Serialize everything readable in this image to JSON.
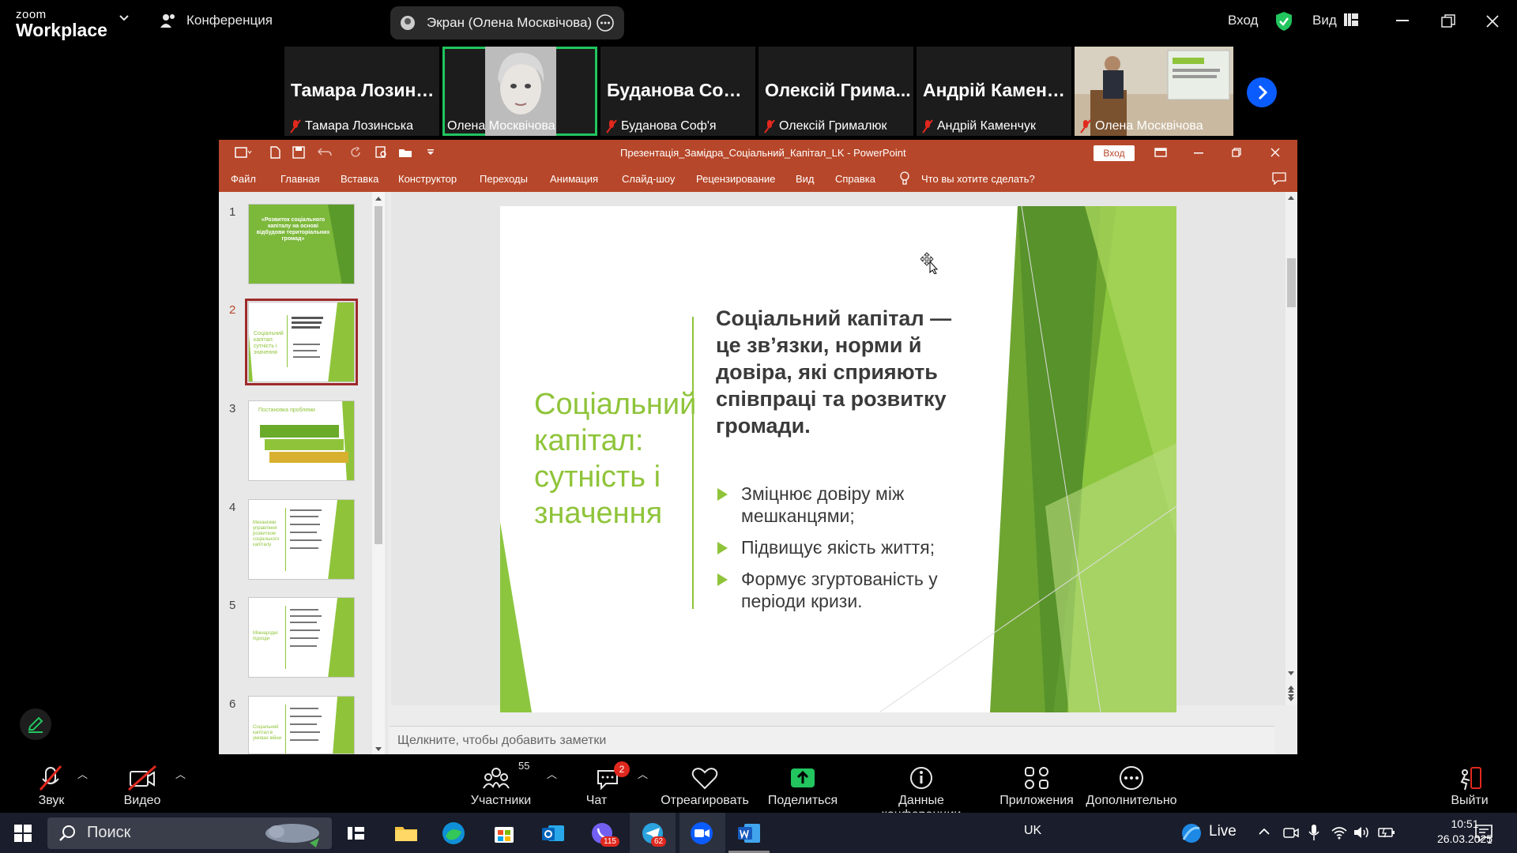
{
  "zoom": {
    "logo_top": "zoom",
    "logo_bottom": "Workplace",
    "conference_label": "Конференция",
    "screen_share_label": "Экран (Олена Москвічова)",
    "login_label": "Вход",
    "view_label": "Вид"
  },
  "participants": [
    {
      "big_name": "Тамара Лозинськ...",
      "label": "Тамара Лозинська",
      "video": false
    },
    {
      "big_name": "",
      "label": "Олена Москвічова",
      "video": true,
      "active": true
    },
    {
      "big_name": "Буданова Соф'я",
      "label": "Буданова Соф'я",
      "video": false
    },
    {
      "big_name": "Олексій Грима...",
      "label": "Олексій Грималюк",
      "video": false
    },
    {
      "big_name": "Андрій Каменч...",
      "label": "Андрій Каменчук",
      "video": false
    },
    {
      "big_name": "",
      "label": "Олена Москвічова",
      "video": true
    }
  ],
  "ppt": {
    "window_title": "Презентація_Замідра_Соціальний_Капітал_LK - PowerPoint",
    "login_label": "Вход",
    "menu": [
      "Файл",
      "Главная",
      "Вставка",
      "Конструктор",
      "Переходы",
      "Анимация",
      "Слайд-шоу",
      "Рецензирование",
      "Вид",
      "Справка",
      "Что вы хотите сделать?"
    ],
    "notes_placeholder": "Щелкните, чтобы добавить заметки",
    "thumbnails": [
      {
        "num": "1",
        "text": "«Розвиток соціального капіталу на основі відбудови територіальних громад»"
      },
      {
        "num": "2",
        "text": "Соціальний капітал: сутність і значення"
      },
      {
        "num": "3",
        "text": "Постановка проблеми"
      },
      {
        "num": "4",
        "text": "Механізми управління розвитком соціального капіталу"
      },
      {
        "num": "5",
        "text": "Міжнародні підходи"
      },
      {
        "num": "6",
        "text": "Соціальний капітал в умовах війни"
      }
    ],
    "slide": {
      "title": "Соціальний капітал: сутність і значення",
      "heading": "Соціальний капітал — це зв’язки, норми й довіра, які сприяють співпраці та розвитку громади.",
      "bullets": [
        "Зміцнює довіру між мешканцями;",
        "Підвищує якість життя;",
        "Формує згуртованість у періоди кризи."
      ]
    }
  },
  "toolbar": {
    "audio": "Звук",
    "video": "Видео",
    "participants": "Участники",
    "participants_count": "55",
    "chat": "Чат",
    "chat_badge": "2",
    "react": "Отреагировать",
    "share": "Поделиться",
    "meeting_info": "Данные конференции",
    "apps": "Приложения",
    "more": "Дополнительно",
    "leave": "Выйти"
  },
  "taskbar": {
    "search_label": "Поиск",
    "lang": "UK",
    "live_label": "Live",
    "time": "10:51",
    "date": "26.03.2025",
    "viber_badge": "115",
    "telegram_badge": "62",
    "notif_badge": "1"
  }
}
